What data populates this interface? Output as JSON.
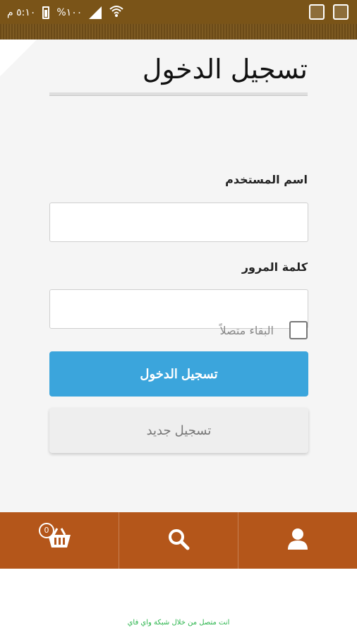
{
  "status_bar": {
    "time": "٥:١٠ م",
    "battery": "%١٠٠"
  },
  "login": {
    "title": "تسجيل الدخول",
    "username_label": "اسم المستخدم",
    "username_value": "",
    "password_label": "كلمة المرور",
    "password_value": "",
    "remember_label": "البقاء متصلاً",
    "login_button": "تسجيل الدخول",
    "register_button": "تسجيل جديد"
  },
  "bottom_nav": {
    "cart_count": "0",
    "icons": [
      "cart-icon",
      "search-icon",
      "user-icon"
    ]
  },
  "footer": {
    "wifi_note": "انت متصل من خلال شبكة واي فاي"
  },
  "colors": {
    "status_bar": "#7a5418",
    "bottom_bar": "#b4561a",
    "login_button": "#3ba5dc",
    "wifi_note": "#28b44a"
  }
}
